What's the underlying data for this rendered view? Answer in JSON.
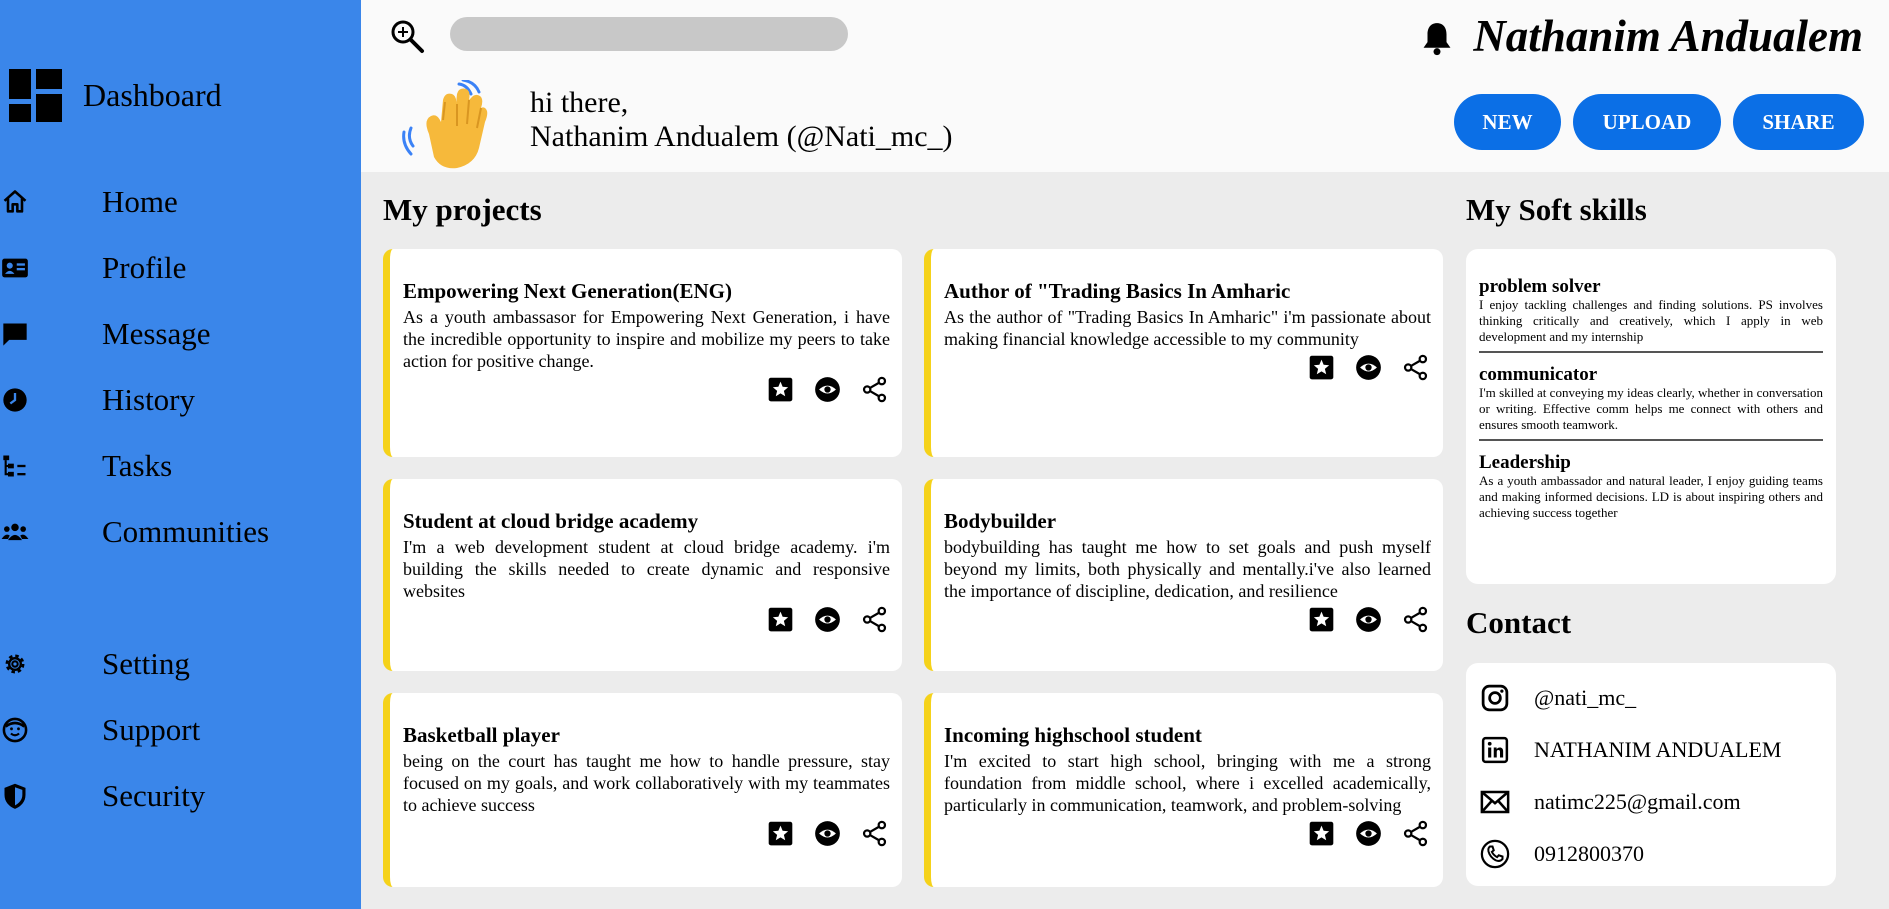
{
  "sidebar": {
    "brand_label": "Dashboard",
    "items": [
      {
        "label": "Home",
        "icon": "home-icon"
      },
      {
        "label": "Profile",
        "icon": "id-card-icon"
      },
      {
        "label": "Message",
        "icon": "message-icon"
      },
      {
        "label": "History",
        "icon": "clock-icon"
      },
      {
        "label": "Tasks",
        "icon": "tasks-icon"
      },
      {
        "label": "Communities",
        "icon": "people-icon"
      },
      {
        "label": "Setting",
        "icon": "gear-icon"
      },
      {
        "label": "Support",
        "icon": "support-icon"
      },
      {
        "label": "Security",
        "icon": "shield-icon"
      }
    ]
  },
  "header": {
    "user_name": "Nathanim Andualem",
    "greeting_line1": "hi there,",
    "greeting_line2": "Nathanim Andualem (@Nati_mc_)",
    "buttons": {
      "new": "NEW",
      "upload": "UPLOAD",
      "share": "SHARE"
    }
  },
  "projects": {
    "title": "My projects",
    "cards": [
      {
        "title": "Empowering Next Generation(ENG)",
        "text": "As a youth ambassasor for Empowering Next Generation, i have the incredible opportunity to inspire and mobilize my peers to take action for positive change."
      },
      {
        "title": "Author of \"Trading Basics In Amharic",
        "text": "As the author of \"Trading Basics In Amharic\" i'm passionate about making financial knowledge accessible to my community"
      },
      {
        "title": "Student at cloud bridge academy",
        "text": "I'm a web development student at cloud bridge academy. i'm building the skills needed to create dynamic and responsive websites"
      },
      {
        "title": "Bodybuilder",
        "text": "bodybuilding has taught me how to set goals and push myself beyond my limits, both physically and mentally.i've also learned the importance of discipline, dedication, and resilience"
      },
      {
        "title": "Basketball player",
        "text": "being on the court has taught me how to handle pressure, stay focused on my goals, and work collaboratively with my teammates to achieve success"
      },
      {
        "title": "Incoming highschool student",
        "text": "I'm excited to start high school, bringing with me a strong foundation from middle school, where i excelled academically, particularly in communication, teamwork, and problem-solving"
      }
    ]
  },
  "skills": {
    "title": "My Soft skills",
    "items": [
      {
        "title": "problem solver",
        "text": "I enjoy tackling challenges and finding solutions. PS involves thinking critically and creatively, which I apply in web development and my internship"
      },
      {
        "title": "communicator",
        "text": "I'm skilled at conveying my ideas clearly, whether in conversation or writing. Effective comm helps me connect with others and ensures smooth teamwork."
      },
      {
        "title": "Leadership",
        "text": "As a youth ambassador and natural leader, I enjoy guiding teams and making informed decisions. LD is about inspiring others and achieving success together"
      }
    ]
  },
  "contact": {
    "title": "Contact",
    "instagram": "@nati_mc_",
    "linkedin": "NATHANIM ANDUALEM",
    "email": "natimc225@gmail.com",
    "phone": "0912800370"
  },
  "colors": {
    "sidebar": "#3a86ea",
    "button": "#0b6fe6",
    "card_accent": "#f5d21a",
    "search_bar": "#c8c8c8"
  }
}
